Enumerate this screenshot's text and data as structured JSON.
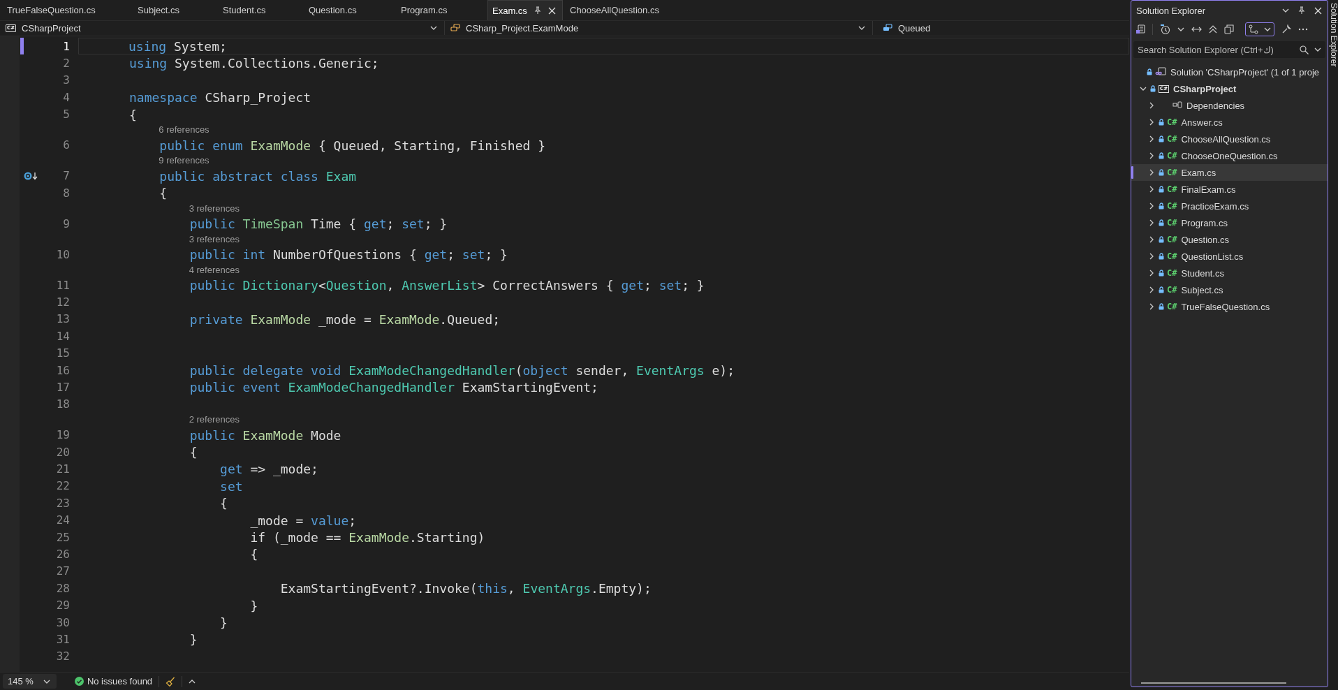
{
  "tabs": [
    {
      "label": "TrueFalseQuestion.cs",
      "selected": false
    },
    {
      "label": "Subject.cs",
      "selected": false
    },
    {
      "label": "Student.cs",
      "selected": false
    },
    {
      "label": "Question.cs",
      "selected": false
    },
    {
      "label": "Program.cs",
      "selected": false
    },
    {
      "label": "Exam.cs",
      "selected": true
    },
    {
      "label": "ChooseAllQuestion.cs",
      "selected": false
    }
  ],
  "navigation": {
    "project_badge": "C#",
    "project": "CSharpProject",
    "type": "CSharp_Project.ExamMode",
    "member": "Queued"
  },
  "editor": {
    "lines": [
      {
        "kind": "code",
        "number": "1",
        "current": true,
        "changed": true,
        "glyph": false,
        "tokens": [
          {
            "kind": "keyword",
            "text": "using"
          },
          {
            "kind": "plain",
            "text": " System;"
          }
        ]
      },
      {
        "kind": "code",
        "number": "2",
        "current": false,
        "changed": false,
        "glyph": false,
        "tokens": [
          {
            "kind": "keyword",
            "text": "using"
          },
          {
            "kind": "plain",
            "text": " System.Collections.Generic;"
          }
        ]
      },
      {
        "kind": "code",
        "number": "3",
        "current": false,
        "changed": false,
        "glyph": false
      },
      {
        "kind": "code",
        "number": "4",
        "current": false,
        "changed": false,
        "glyph": false,
        "tokens": [
          {
            "kind": "keyword",
            "text": "namespace"
          },
          {
            "kind": "plain",
            "text": " CSharp_Project"
          }
        ]
      },
      {
        "kind": "code",
        "number": "5",
        "current": false,
        "changed": false,
        "glyph": false,
        "tokens": [
          {
            "kind": "plain",
            "text": "{"
          }
        ]
      },
      {
        "kind": "lens",
        "text": "6 references"
      },
      {
        "kind": "code",
        "number": "6",
        "current": false,
        "changed": false,
        "glyph": false,
        "tokens": [
          {
            "kind": "keyword",
            "text": "    public enum"
          },
          {
            "kind": "enum",
            "text": " ExamMode"
          },
          {
            "kind": "plain",
            "text": " { Queued, Starting, Finished }"
          }
        ]
      },
      {
        "kind": "lens",
        "text": "9 references"
      },
      {
        "kind": "code",
        "number": "7",
        "current": false,
        "changed": false,
        "glyph": true,
        "tokens": [
          {
            "kind": "keyword",
            "text": "    public abstract class"
          },
          {
            "kind": "class",
            "text": " Exam"
          }
        ]
      },
      {
        "kind": "code",
        "number": "8",
        "current": false,
        "changed": false,
        "glyph": false,
        "tokens": [
          {
            "kind": "plain",
            "text": "    {"
          }
        ]
      },
      {
        "kind": "lens",
        "text": "3 references"
      },
      {
        "kind": "code",
        "number": "9",
        "current": false,
        "changed": false,
        "glyph": false,
        "tokens": [
          {
            "kind": "keyword",
            "text": "        public"
          },
          {
            "kind": "struct",
            "text": " TimeSpan"
          },
          {
            "kind": "plain",
            "text": " Time { "
          },
          {
            "kind": "keyword",
            "text": "get"
          },
          {
            "kind": "plain",
            "text": "; "
          },
          {
            "kind": "keyword",
            "text": "set"
          },
          {
            "kind": "plain",
            "text": "; }"
          }
        ]
      },
      {
        "kind": "lens",
        "text": "3 references"
      },
      {
        "kind": "code",
        "number": "10",
        "current": false,
        "changed": false,
        "glyph": false,
        "tokens": [
          {
            "kind": "keyword",
            "text": "        public int"
          },
          {
            "kind": "plain",
            "text": " NumberOfQuestions { "
          },
          {
            "kind": "keyword",
            "text": "get"
          },
          {
            "kind": "plain",
            "text": "; "
          },
          {
            "kind": "keyword",
            "text": "set"
          },
          {
            "kind": "plain",
            "text": "; }"
          }
        ]
      },
      {
        "kind": "lens",
        "text": "4 references"
      },
      {
        "kind": "code",
        "number": "11",
        "current": false,
        "changed": false,
        "glyph": false,
        "tokens": [
          {
            "kind": "keyword",
            "text": "        public"
          },
          {
            "kind": "class",
            "text": " Dictionary"
          },
          {
            "kind": "plain",
            "text": "<"
          },
          {
            "kind": "class",
            "text": "Question"
          },
          {
            "kind": "plain",
            "text": ", "
          },
          {
            "kind": "class",
            "text": "AnswerList"
          },
          {
            "kind": "plain",
            "text": "> CorrectAnswers { "
          },
          {
            "kind": "keyword",
            "text": "get"
          },
          {
            "kind": "plain",
            "text": "; "
          },
          {
            "kind": "keyword",
            "text": "set"
          },
          {
            "kind": "plain",
            "text": "; }"
          }
        ]
      },
      {
        "kind": "code",
        "number": "12",
        "current": false,
        "changed": false,
        "glyph": false
      },
      {
        "kind": "code",
        "number": "13",
        "current": false,
        "changed": false,
        "glyph": false,
        "tokens": [
          {
            "kind": "keyword",
            "text": "        private"
          },
          {
            "kind": "enum",
            "text": " ExamMode"
          },
          {
            "kind": "plain",
            "text": " _mode = "
          },
          {
            "kind": "enum",
            "text": "ExamMode"
          },
          {
            "kind": "plain",
            "text": ".Queued;"
          }
        ]
      },
      {
        "kind": "code",
        "number": "14",
        "current": false,
        "changed": false,
        "glyph": false
      },
      {
        "kind": "code",
        "number": "15",
        "current": false,
        "changed": false,
        "glyph": false
      },
      {
        "kind": "code",
        "number": "16",
        "current": false,
        "changed": false,
        "glyph": false,
        "tokens": [
          {
            "kind": "keyword",
            "text": "        public delegate void"
          },
          {
            "kind": "class",
            "text": " ExamModeChangedHandler"
          },
          {
            "kind": "plain",
            "text": "("
          },
          {
            "kind": "keyword",
            "text": "object"
          },
          {
            "kind": "plain",
            "text": " sender, "
          },
          {
            "kind": "class",
            "text": "EventArgs"
          },
          {
            "kind": "plain",
            "text": " e);"
          }
        ]
      },
      {
        "kind": "code",
        "number": "17",
        "current": false,
        "changed": false,
        "glyph": false,
        "tokens": [
          {
            "kind": "keyword",
            "text": "        public event"
          },
          {
            "kind": "class",
            "text": " ExamModeChangedHandler"
          },
          {
            "kind": "plain",
            "text": " ExamStartingEvent;"
          }
        ]
      },
      {
        "kind": "code",
        "number": "18",
        "current": false,
        "changed": false,
        "glyph": false
      },
      {
        "kind": "lens",
        "text": "2 references"
      },
      {
        "kind": "code",
        "number": "19",
        "current": false,
        "changed": false,
        "glyph": false,
        "tokens": [
          {
            "kind": "keyword",
            "text": "        public"
          },
          {
            "kind": "enum",
            "text": " ExamMode"
          },
          {
            "kind": "plain",
            "text": " Mode"
          }
        ]
      },
      {
        "kind": "code",
        "number": "20",
        "current": false,
        "changed": false,
        "glyph": false,
        "tokens": [
          {
            "kind": "plain",
            "text": "        {"
          }
        ]
      },
      {
        "kind": "code",
        "number": "21",
        "current": false,
        "changed": false,
        "glyph": false,
        "tokens": [
          {
            "kind": "keyword",
            "text": "            get"
          },
          {
            "kind": "plain",
            "text": " => _mode;"
          }
        ]
      },
      {
        "kind": "code",
        "number": "22",
        "current": false,
        "changed": false,
        "glyph": false,
        "tokens": [
          {
            "kind": "keyword",
            "text": "            set"
          }
        ]
      },
      {
        "kind": "code",
        "number": "23",
        "current": false,
        "changed": false,
        "glyph": false,
        "tokens": [
          {
            "kind": "plain",
            "text": "            {"
          }
        ]
      },
      {
        "kind": "code",
        "number": "24",
        "current": false,
        "changed": false,
        "glyph": false,
        "tokens": [
          {
            "kind": "plain",
            "text": "                _mode = "
          },
          {
            "kind": "keyword",
            "text": "value"
          },
          {
            "kind": "plain",
            "text": ";"
          }
        ]
      },
      {
        "kind": "code",
        "number": "25",
        "current": false,
        "changed": false,
        "glyph": false,
        "tokens": [
          {
            "kind": "plain",
            "text": "                if (_mode == "
          },
          {
            "kind": "enum",
            "text": "ExamMode"
          },
          {
            "kind": "plain",
            "text": ".Starting)"
          }
        ]
      },
      {
        "kind": "code",
        "number": "26",
        "current": false,
        "changed": false,
        "glyph": false,
        "tokens": [
          {
            "kind": "plain",
            "text": "                {"
          }
        ]
      },
      {
        "kind": "code",
        "number": "27",
        "current": false,
        "changed": false,
        "glyph": false
      },
      {
        "kind": "code",
        "number": "28",
        "current": false,
        "changed": false,
        "glyph": false,
        "tokens": [
          {
            "kind": "plain",
            "text": "                    ExamStartingEvent?.Invoke("
          },
          {
            "kind": "keyword",
            "text": "this"
          },
          {
            "kind": "plain",
            "text": ", "
          },
          {
            "kind": "class",
            "text": "EventArgs"
          },
          {
            "kind": "plain",
            "text": ".Empty);"
          }
        ]
      },
      {
        "kind": "code",
        "number": "29",
        "current": false,
        "changed": false,
        "glyph": false,
        "tokens": [
          {
            "kind": "plain",
            "text": "                }"
          }
        ]
      },
      {
        "kind": "code",
        "number": "30",
        "current": false,
        "changed": false,
        "glyph": false,
        "tokens": [
          {
            "kind": "plain",
            "text": "            }"
          }
        ]
      },
      {
        "kind": "code",
        "number": "31",
        "current": false,
        "changed": false,
        "glyph": false,
        "tokens": [
          {
            "kind": "plain",
            "text": "        }"
          }
        ]
      },
      {
        "kind": "code",
        "number": "32",
        "current": false,
        "changed": false,
        "glyph": false
      }
    ]
  },
  "status_bar": {
    "zoom": "145 %",
    "issues": "No issues found"
  },
  "solution_explorer": {
    "title": "Solution Explorer",
    "search": {
      "placeholder": "Search Solution Explorer (Ctrl+ك)"
    },
    "tree": [
      {
        "kind": "solution",
        "label": "Solution 'CSharpProject' (1 of 1 proje",
        "locked": true,
        "selected": false,
        "children": [
          {
            "kind": "project",
            "label": "CSharpProject",
            "badge": "C#",
            "locked": true,
            "expanded": true,
            "selected": false,
            "children": [
              {
                "kind": "dependencies",
                "label": "Dependencies",
                "locked": false,
                "expanded": false,
                "selected": false
              },
              {
                "kind": "file",
                "label": "Answer.cs",
                "badge": "C#",
                "locked": true,
                "expanded": false,
                "selected": false
              },
              {
                "kind": "file",
                "label": "ChooseAllQuestion.cs",
                "badge": "C#",
                "locked": true,
                "expanded": false,
                "selected": false
              },
              {
                "kind": "file",
                "label": "ChooseOneQuestion.cs",
                "badge": "C#",
                "locked": true,
                "expanded": false,
                "selected": false
              },
              {
                "kind": "file",
                "label": "Exam.cs",
                "badge": "C#",
                "locked": true,
                "expanded": false,
                "selected": true
              },
              {
                "kind": "file",
                "label": "FinalExam.cs",
                "badge": "C#",
                "locked": true,
                "expanded": false,
                "selected": false
              },
              {
                "kind": "file",
                "label": "PracticeExam.cs",
                "badge": "C#",
                "locked": true,
                "expanded": false,
                "selected": false
              },
              {
                "kind": "file",
                "label": "Program.cs",
                "badge": "C#",
                "locked": true,
                "expanded": false,
                "selected": false
              },
              {
                "kind": "file",
                "label": "Question.cs",
                "badge": "C#",
                "locked": true,
                "expanded": false,
                "selected": false
              },
              {
                "kind": "file",
                "label": "QuestionList.cs",
                "badge": "C#",
                "locked": true,
                "expanded": false,
                "selected": false
              },
              {
                "kind": "file",
                "label": "Student.cs",
                "badge": "C#",
                "locked": true,
                "expanded": false,
                "selected": false
              },
              {
                "kind": "file",
                "label": "Subject.cs",
                "badge": "C#",
                "locked": true,
                "expanded": false,
                "selected": false
              },
              {
                "kind": "file",
                "label": "TrueFalseQuestion.cs",
                "badge": "C#",
                "locked": true,
                "expanded": false,
                "selected": false
              }
            ]
          }
        ]
      }
    ]
  },
  "side_tab": "Solution Explorer"
}
